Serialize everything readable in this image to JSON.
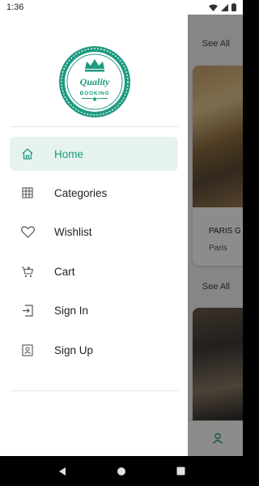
{
  "status_bar": {
    "time": "1:36"
  },
  "background": {
    "see_all_1": "See All",
    "see_all_2": "See All",
    "card_title": "PARIS G",
    "card_subtitle": "Paris"
  },
  "logo": {
    "line1": "Quality",
    "line2": "BOOKING"
  },
  "menu": {
    "items": [
      {
        "label": "Home",
        "icon": "home-icon",
        "active": true
      },
      {
        "label": "Categories",
        "icon": "grid-icon",
        "active": false
      },
      {
        "label": "Wishlist",
        "icon": "heart-icon",
        "active": false
      },
      {
        "label": "Cart",
        "icon": "cart-icon",
        "active": false
      },
      {
        "label": "Sign In",
        "icon": "sign-in-icon",
        "active": false
      },
      {
        "label": "Sign Up",
        "icon": "sign-up-icon",
        "active": false
      }
    ]
  },
  "colors": {
    "accent": "#1f9a80",
    "active_bg": "#e6f3ef"
  }
}
